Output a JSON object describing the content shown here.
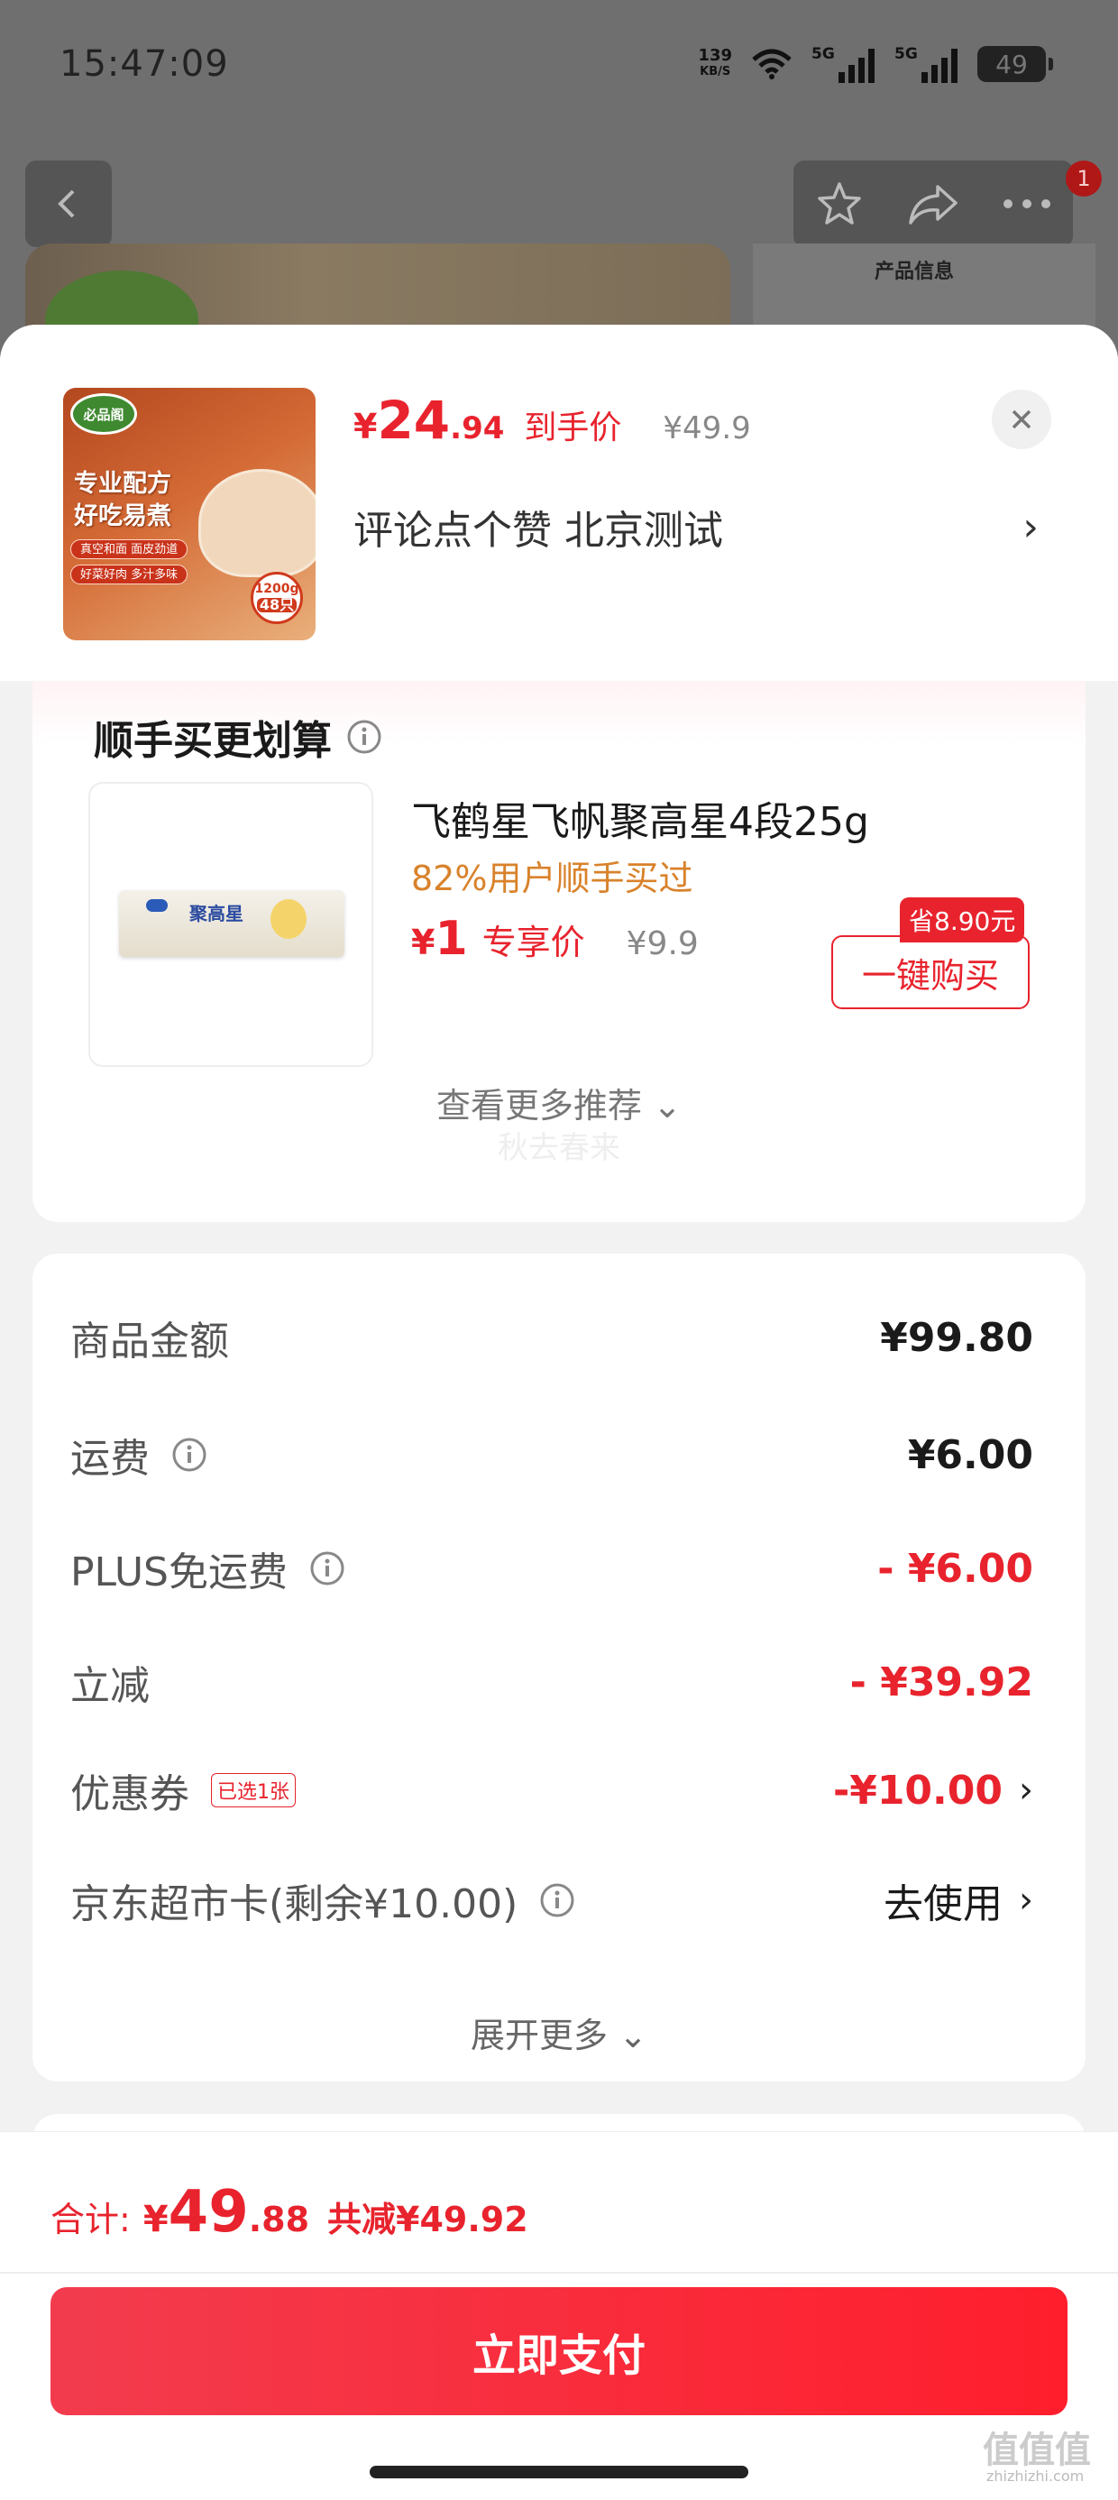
{
  "status_bar": {
    "time": "15:47:09",
    "net_speed": "139",
    "net_unit": "KB/S",
    "sim1": "5G",
    "sim2": "5G",
    "battery": "49"
  },
  "background_page": {
    "nav_badge": "1",
    "info_label": "产品信息",
    "icons": [
      "back-icon",
      "star-icon",
      "share-icon",
      "more-icon"
    ]
  },
  "product": {
    "image_text": {
      "brand": "必品阁",
      "line1": "专业配方",
      "line2": "好吃易煮",
      "pill1": "真空和面 面皮劲道",
      "pill2": "好菜好肉 多汁多味",
      "weight": "1200g",
      "count": "48只"
    },
    "price_yen": "¥",
    "price_int": "24",
    "price_dec": ".94",
    "price_label": "到手价",
    "original_price": "¥49.9",
    "spec": "评论点个赞  北京测试",
    "spec_chevron": "›"
  },
  "addon": {
    "title": "顺手买更划算",
    "name": "飞鹤星飞帆聚高星4段25g",
    "subtitle": "82%用户顺手买过",
    "pack_label": "聚高星",
    "price_yen": "¥",
    "price_int": "1",
    "price_label": "专享价",
    "original_price": "¥9.9",
    "save_tag": "省8.90元",
    "buy_button": "一键购买",
    "more_link": "查看更多推荐 ⌄",
    "watermark": "秋去春来"
  },
  "fees": {
    "rows": [
      {
        "label": "商品金额",
        "value": "¥99.80"
      },
      {
        "label": "运费",
        "value": "¥6.00"
      },
      {
        "label": "PLUS免运费",
        "value": "- ¥6.00"
      },
      {
        "label": "立减",
        "value": "- ¥39.92"
      },
      {
        "label": "优惠券",
        "tag": "已选1张",
        "value": "-¥10.00"
      },
      {
        "label": "京东超市卡(剩余¥10.00)",
        "value": "去使用"
      }
    ],
    "expand": "展开更多 ⌄"
  },
  "footer": {
    "total_label": "合计:",
    "total_yen": "¥",
    "total_int": "49",
    "total_dec": ".88",
    "discount": "共减¥49.92",
    "pay_button": "立即支付",
    "site_mark": "值值值",
    "site_url": "zhizhizhi.com"
  },
  "colors": {
    "accent_red": "#e8232d",
    "addon_orange": "#d9822b",
    "pay_gradient_start": "#f23c4e",
    "pay_gradient_end": "#ff1e2c"
  }
}
